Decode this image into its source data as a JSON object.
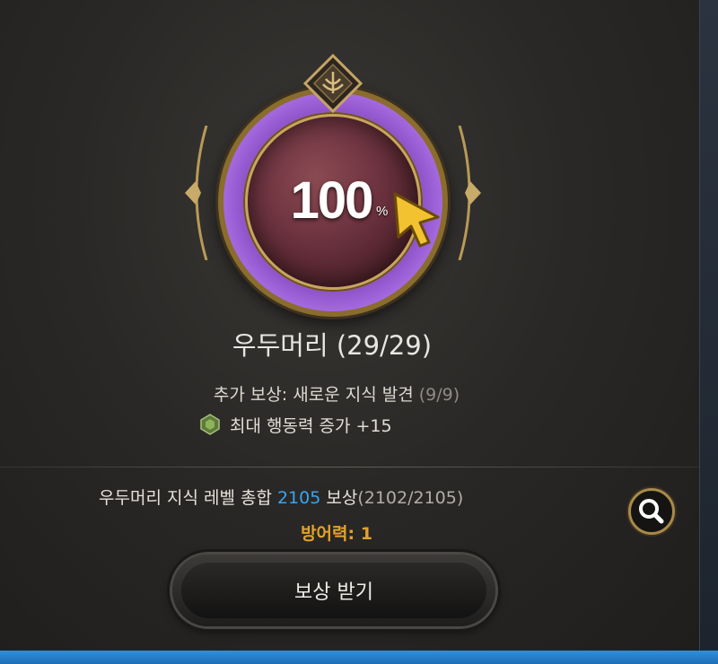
{
  "progress": {
    "value": "100",
    "unit": "%",
    "fraction": 1.0
  },
  "knowledge": {
    "name": "우두머리 (29/29)",
    "bonus_label": "추가 보상: 새로운 지식 발견",
    "bonus_count": " (9/9)",
    "stat_text": "최대 행동력 증가 +15",
    "stat_icon": "green-gem-icon"
  },
  "total": {
    "prefix": "우두머리 지식 레벨 총합 ",
    "level": "2105",
    "suffix": " 보상",
    "count": "(2102/2105)"
  },
  "reward": {
    "defense": "방어력: 1"
  },
  "buttons": {
    "claim_label": "보상 받기",
    "search_icon": "magnifier-icon"
  },
  "colors": {
    "accent_blue": "#3aa4ef",
    "defense_gold": "#e3a22a",
    "ring_purple": "#8f53c9"
  }
}
